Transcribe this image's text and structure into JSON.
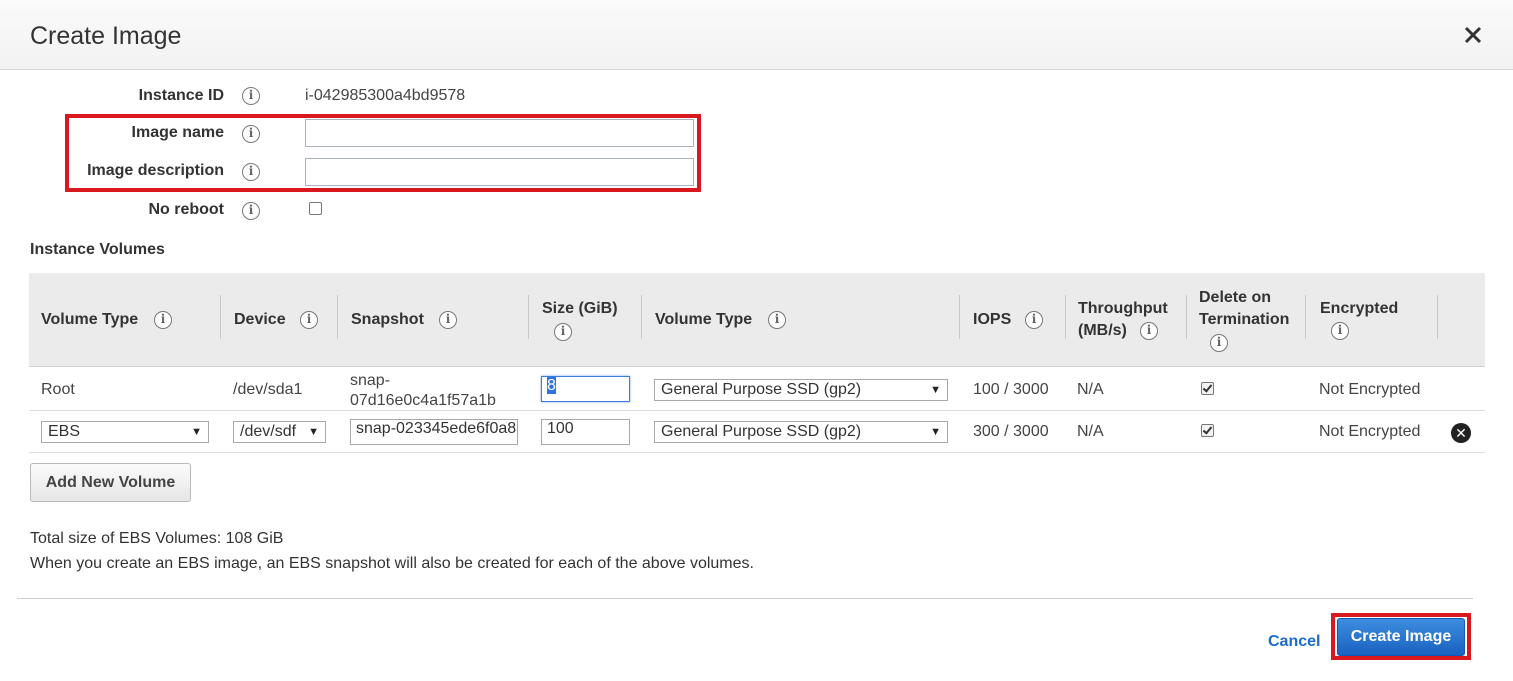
{
  "dialog": {
    "title": "Create Image",
    "close_icon": "close-icon"
  },
  "form": {
    "instance_id_label": "Instance ID",
    "instance_id_value": "i-042985300a4bd9578",
    "image_name_label": "Image name",
    "image_name_value": "",
    "image_description_label": "Image description",
    "image_description_value": "",
    "no_reboot_label": "No reboot",
    "no_reboot_checked": false
  },
  "volumes": {
    "section_title": "Instance Volumes",
    "headers": {
      "volume_type": "Volume Type",
      "device": "Device",
      "snapshot": "Snapshot",
      "size_line1": "Size (GiB)",
      "volume_type2": "Volume Type",
      "iops": "IOPS",
      "throughput_line1": "Throughput",
      "throughput_line2": "(MB/s)",
      "delete_line1": "Delete on",
      "delete_line2": "Termination",
      "encrypted": "Encrypted"
    },
    "rows": [
      {
        "volume_type": "Root",
        "device": "/dev/sda1",
        "snapshot_line1": "snap-",
        "snapshot_line2": "07d16e0c4a1f57a1b",
        "size": "8",
        "ebs_type": "General Purpose SSD (gp2)",
        "iops": "100 / 3000",
        "throughput": "N/A",
        "delete_on_termination": true,
        "encrypted": "Not Encrypted"
      },
      {
        "volume_type": "EBS",
        "device": "/dev/sdf",
        "snapshot": "snap-023345ede6f0a8",
        "size": "100",
        "ebs_type": "General Purpose SSD (gp2)",
        "iops": "300 / 3000",
        "throughput": "N/A",
        "delete_on_termination": true,
        "encrypted": "Not Encrypted"
      }
    ],
    "add_button": "Add New Volume",
    "total_size": "Total size of EBS Volumes: 108 GiB",
    "note": "When you create an EBS image, an EBS snapshot will also be created for each of the above volumes."
  },
  "footer": {
    "cancel_label": "Cancel",
    "create_label": "Create Image"
  },
  "colors": {
    "highlight": "#d9191f",
    "primary": "#1a62c0",
    "link": "#1a6dcc"
  }
}
